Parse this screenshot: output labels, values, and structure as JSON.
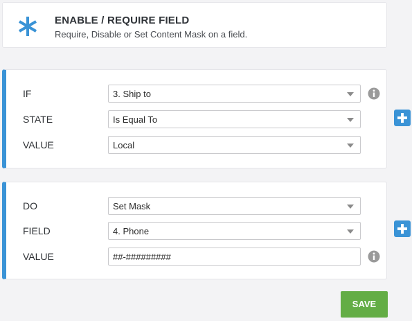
{
  "header": {
    "title": "ENABLE / REQUIRE FIELD",
    "subtitle": "Require, Disable or Set Content Mask on a field.",
    "icon": "asterisk-icon",
    "icon_color": "#3a93d6"
  },
  "condition": {
    "if_label": "IF",
    "if_value": "3. Ship to",
    "state_label": "STATE",
    "state_value": "Is Equal To",
    "value_label": "VALUE",
    "value_value": "Local"
  },
  "action": {
    "do_label": "DO",
    "do_value": "Set Mask",
    "field_label": "FIELD",
    "field_value": "4. Phone",
    "value_label": "VALUE",
    "value_value": "##-#########"
  },
  "buttons": {
    "save_label": "SAVE"
  },
  "colors": {
    "accent": "#3a93d6",
    "save": "#63ad45",
    "background": "#f3f3f5"
  }
}
